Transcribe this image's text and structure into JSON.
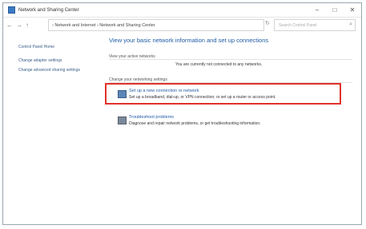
{
  "window": {
    "title": "Network and Sharing Center"
  },
  "controls": {
    "minimize": "–",
    "maximize": "□",
    "close": "✕"
  },
  "nav": {
    "back": "←",
    "forward": "→",
    "up": "↑"
  },
  "address": {
    "breadcrumb": "›  Network and Internet  ›  Network and Sharing Center",
    "refresh": "↻",
    "search_placeholder": "Search Control Panel"
  },
  "sidebar": {
    "items": [
      {
        "label": "Control Panel Home"
      },
      {
        "label": "Change adapter settings"
      },
      {
        "label": "Change advanced sharing settings"
      }
    ]
  },
  "main": {
    "heading": "View your basic network information and set up connections",
    "active_networks_label": "View your active networks",
    "connection_status": "You are currently not connected to any networks.",
    "change_settings_label": "Change your networking settings",
    "tasks": [
      {
        "title": "Set up a new connection or network",
        "description": "Set up a broadband, dial-up, or VPN connection; or set up a router or access point."
      },
      {
        "title": "Troubleshoot problems",
        "description": "Diagnose and repair network problems, or get troubleshooting information."
      }
    ]
  },
  "highlight_color": "#e0322b"
}
